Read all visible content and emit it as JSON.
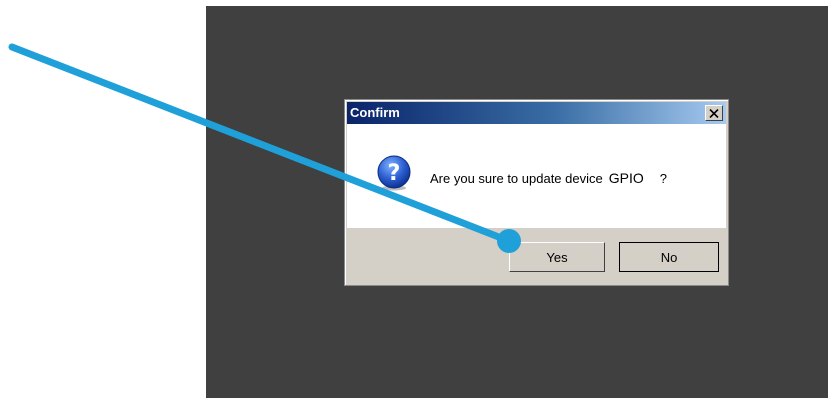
{
  "dialog": {
    "title": "Confirm",
    "message": "Are you sure to update device",
    "device_name": "GPIO",
    "question_suffix": "?",
    "icon": "question-icon",
    "close_icon": "close-icon"
  },
  "buttons": {
    "yes_label": "Yes",
    "no_label": "No"
  },
  "colors": {
    "screen_background": "#404040",
    "title_gradient_start": "#0a246a",
    "title_gradient_end": "#a6caf0",
    "annotation_arrow": "#1fa0d8"
  }
}
